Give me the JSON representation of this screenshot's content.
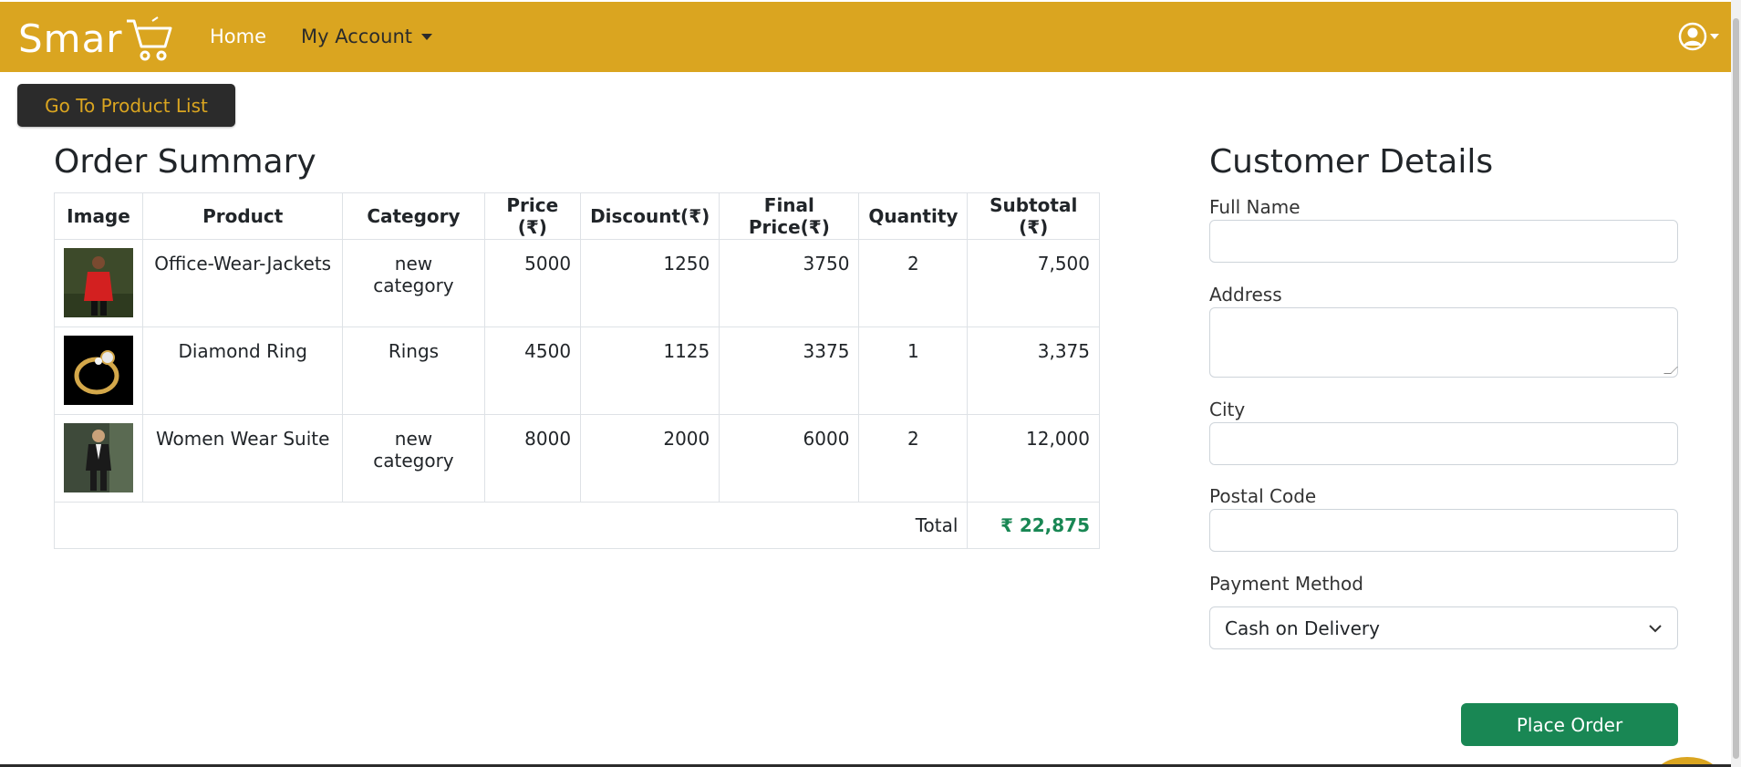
{
  "navbar": {
    "brand": "Smar",
    "home_label": "Home",
    "account_label": "My Account",
    "bg_color": "#daa520"
  },
  "back_button": {
    "label": "Go To Product List"
  },
  "order_summary": {
    "title": "Order Summary",
    "columns": [
      "Image",
      "Product",
      "Category",
      "Price (₹)",
      "Discount(₹)",
      "Final Price(₹)",
      "Quantity",
      "Subtotal (₹)"
    ],
    "rows": [
      {
        "image": "red-jacket-photo",
        "product": "Office-Wear-Jackets",
        "category": "new category",
        "price": "5000",
        "discount": "1250",
        "final_price": "3750",
        "quantity": "2",
        "subtotal": "7,500"
      },
      {
        "image": "diamond-ring-photo",
        "product": "Diamond Ring",
        "category": "Rings",
        "price": "4500",
        "discount": "1125",
        "final_price": "3375",
        "quantity": "1",
        "subtotal": "3,375"
      },
      {
        "image": "women-suit-photo",
        "product": "Women Wear Suite",
        "category": "new category",
        "price": "8000",
        "discount": "2000",
        "final_price": "6000",
        "quantity": "2",
        "subtotal": "12,000"
      }
    ],
    "total_label": "Total",
    "total_value": "₹ 22,875"
  },
  "customer_details": {
    "title": "Customer Details",
    "full_name_label": "Full Name",
    "address_label": "Address",
    "city_label": "City",
    "postal_code_label": "Postal Code",
    "payment_method_label": "Payment Method",
    "payment_method_value": "Cash on Delivery"
  },
  "place_order_button": {
    "label": "Place Order",
    "color": "#198754"
  }
}
